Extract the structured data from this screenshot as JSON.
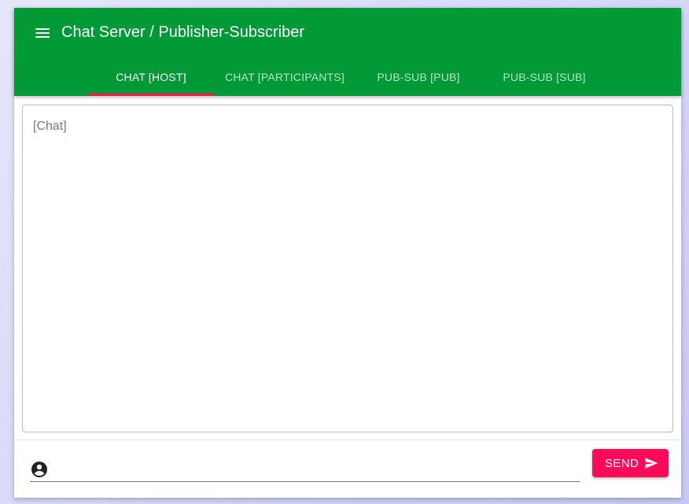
{
  "header": {
    "title": "Chat Server / Publisher-Subscriber",
    "menu_icon": "menu-icon"
  },
  "tabs": [
    {
      "label": "CHAT [HOST]",
      "active": true
    },
    {
      "label": "CHAT [PARTICIPANTS]",
      "active": false
    },
    {
      "label": "PUB-SUB [PUB]",
      "active": false
    },
    {
      "label": "PUB-SUB [SUB]",
      "active": false
    }
  ],
  "chat": {
    "placeholder": "[Chat]"
  },
  "composer": {
    "icon": "account-circle-icon",
    "value": "",
    "send_label": "SEND",
    "send_icon": "send-icon"
  },
  "colors": {
    "appbar": "#029a36",
    "accent": "#ff0a58",
    "tab_indicator": "#ff1053"
  }
}
